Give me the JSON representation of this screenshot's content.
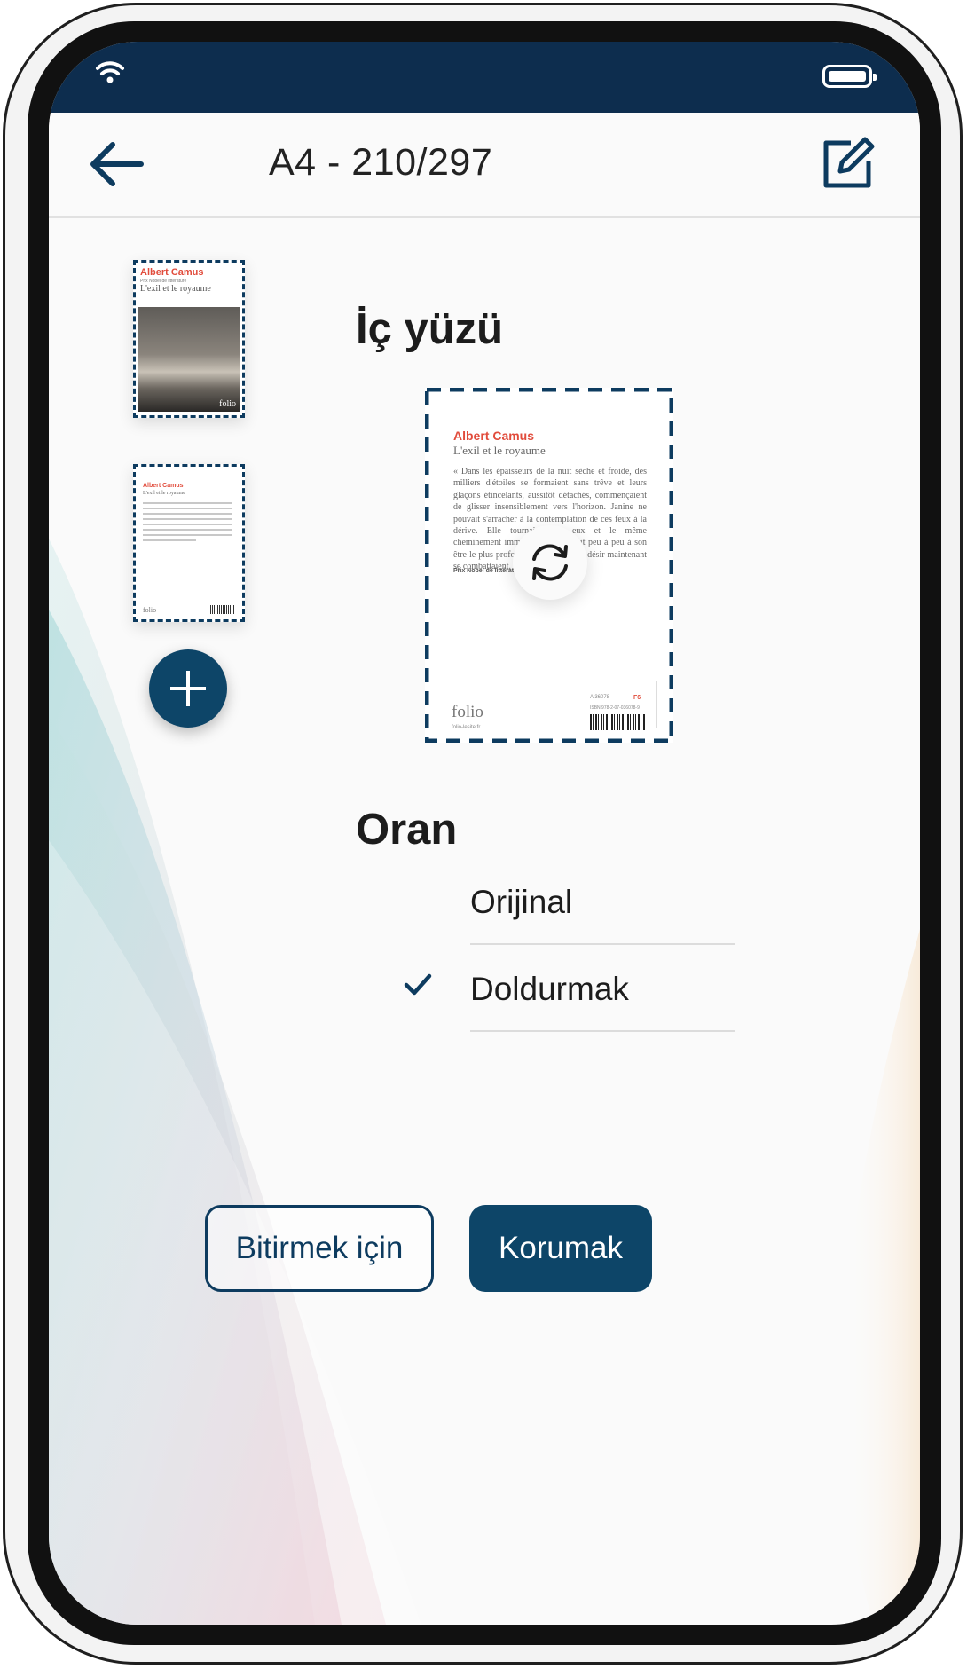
{
  "status_bar": {
    "wifi_icon": "wifi-icon",
    "battery_icon": "battery-icon"
  },
  "header": {
    "title": "A4 - 210/297",
    "back_icon": "arrow-left-icon",
    "edit_icon": "edit-icon"
  },
  "thumbnails": [
    {
      "author": "Albert Camus",
      "publisher": "Prix Nobel de littérature",
      "title": "L'exil et le royaume",
      "brand": "folio"
    },
    {
      "author": "Albert Camus",
      "title": "L'exil et le royaume",
      "brand": "folio"
    }
  ],
  "add_icon": "plus-icon",
  "face_section": {
    "title": "İç yüzü"
  },
  "preview": {
    "author": "Albert Camus",
    "title": "L'exil et le royaume",
    "body": "« Dans les épaisseurs de la nuit sèche et froide, des milliers d'étoiles se formaient sans trêve et leurs glaçons étincelants, aussitôt détachés, commençaient de glisser insensiblement vers l'horizon. Janine ne pouvait s'arracher à la contemplation de ces feux à la dérive. Elle tournait avec eux et le même cheminement immobile la réunissait peu à peu à son être le plus profond, où le froid et le désir maintenant se combattaient. »",
    "prize": "Prix Nobel de littérature 1957",
    "brand": "folio",
    "url": "folio-lesite.fr",
    "code": "A 36078",
    "category": "F6",
    "isbn": "ISBN 978-2-07-036078-9",
    "rotate_icon": "rotate-icon"
  },
  "ratio_section": {
    "title": "Oran",
    "options": [
      {
        "label": "Orijinal",
        "selected": false
      },
      {
        "label": "Doldurmak",
        "selected": true
      }
    ],
    "check_icon": "check-icon"
  },
  "buttons": {
    "finish_label": "Bitirmek için",
    "save_label": "Korumak"
  },
  "colors": {
    "primary": "#0d4568",
    "status_bar": "#0d2d4e",
    "accent_red": "#e14c3c"
  }
}
